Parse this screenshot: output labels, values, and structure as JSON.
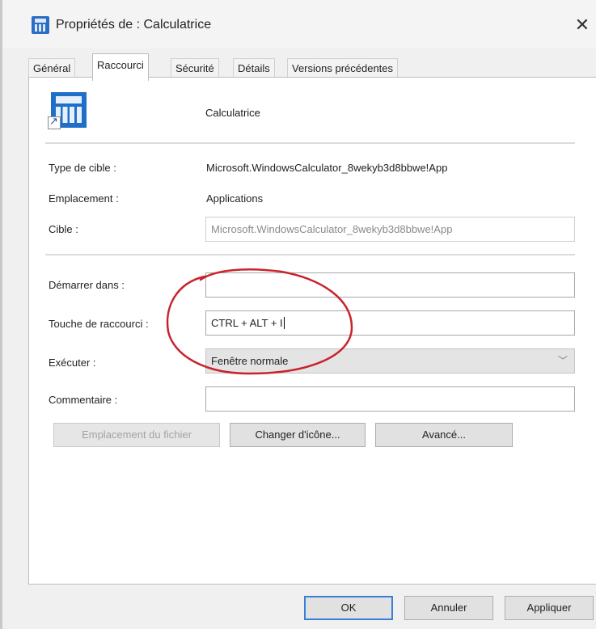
{
  "window": {
    "title": "Propriétés de : Calculatrice",
    "close_glyph": "✕"
  },
  "tabs": [
    {
      "label": "Général"
    },
    {
      "label": "Raccourci",
      "active": true
    },
    {
      "label": "Sécurité"
    },
    {
      "label": "Détails"
    },
    {
      "label": "Versions précédentes"
    }
  ],
  "shortcut": {
    "app_name": "Calculatrice",
    "target_type_label": "Type de cible :",
    "target_type_value": "Microsoft.WindowsCalculator_8wekyb3d8bbwe!App",
    "location_label": "Emplacement :",
    "location_value": "Applications",
    "target_label": "Cible :",
    "target_value": "Microsoft.WindowsCalculator_8wekyb3d8bbwe!App",
    "start_in_label": "Démarrer dans :",
    "start_in_value": "",
    "hotkey_label": "Touche de raccourci :",
    "hotkey_value": "CTRL + ALT + I",
    "run_label": "Exécuter :",
    "run_value": "Fenêtre normale",
    "comment_label": "Commentaire :",
    "comment_value": "",
    "open_location_button": "Emplacement du fichier",
    "change_icon_button": "Changer d'icône...",
    "advanced_button": "Avancé..."
  },
  "footer": {
    "ok_button": "OK",
    "cancel_button": "Annuler",
    "apply_button": "Appliquer"
  },
  "colors": {
    "accent": "#3c7fd6",
    "annotation": "#c8232c",
    "app_icon": "#1f6fc9"
  },
  "icons": {
    "title": "calculator-icon",
    "app": "calculator-shortcut-icon",
    "close": "close-icon",
    "dropdown": "chevron-down-icon"
  }
}
